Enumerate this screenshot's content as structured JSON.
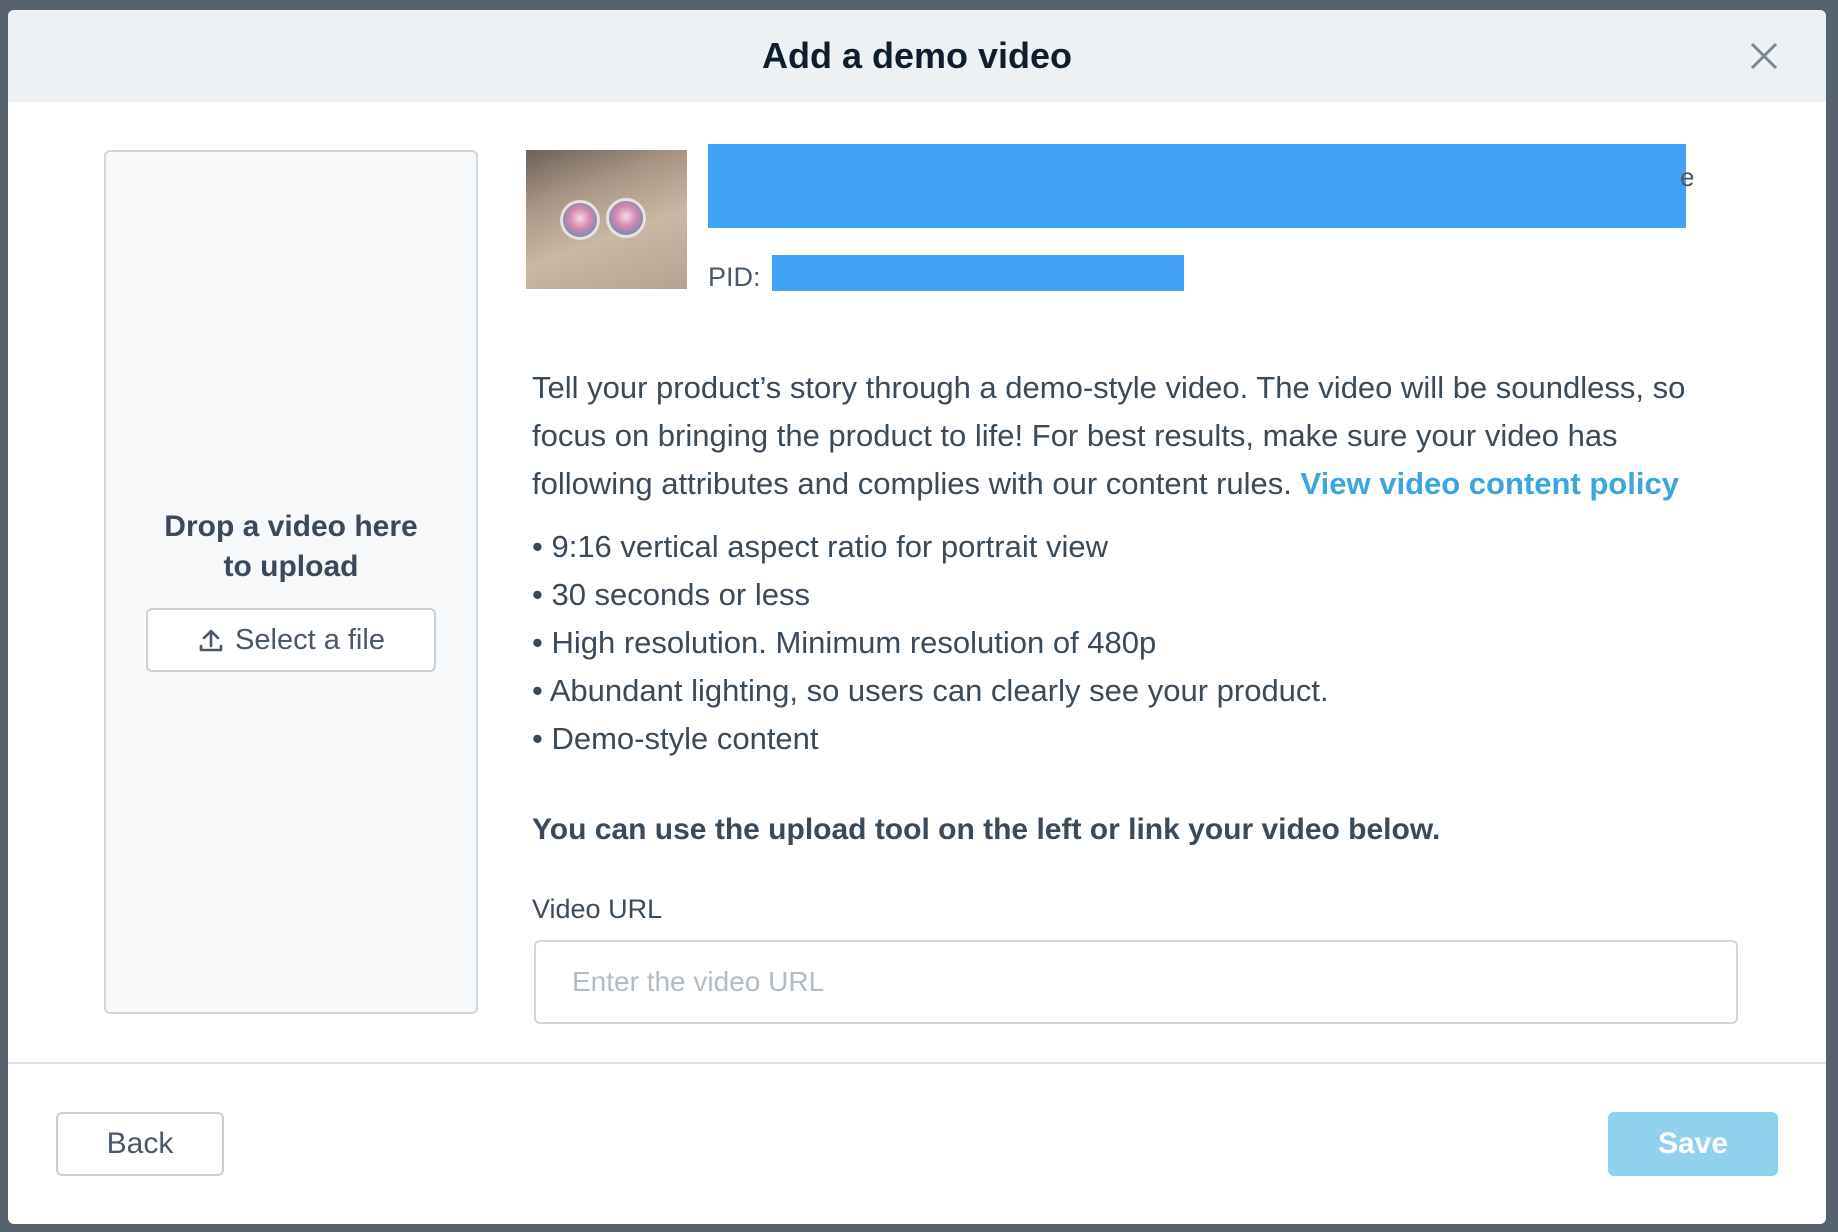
{
  "modal": {
    "title": "Add a demo video",
    "close_icon": "close-icon"
  },
  "dropzone": {
    "text_line1": "Drop a video here",
    "text_line2": "to upload",
    "select_button_label": "Select a file",
    "select_button_icon": "upload-icon"
  },
  "product": {
    "title_tail": "e",
    "pid_label": "PID:",
    "title_redacted": true,
    "pid_redacted": true,
    "redaction_color": "#42a2f5"
  },
  "description": {
    "text": "Tell your product’s story through a demo-style video. The video will be soundless, so focus on bringing the product to life! For best results, make sure your video has following attributes and complies with our content rules.",
    "link_text": "View video content policy"
  },
  "requirements": [
    "• 9:16 vertical aspect ratio for portrait view",
    "• 30 seconds or less",
    "• High resolution. Minimum resolution of 480p",
    "• Abundant lighting, so users can clearly see your product.",
    "• Demo-style content"
  ],
  "hint": "You can use the upload tool on the left or link your video below.",
  "video_url": {
    "label": "Video URL",
    "value": "",
    "placeholder": "Enter the video URL"
  },
  "footer": {
    "back_label": "Back",
    "save_label": "Save",
    "save_disabled": true
  },
  "colors": {
    "link": "#3aa6dd",
    "save_disabled_bg": "#90d2ee",
    "header_bg": "#eef1f4"
  }
}
